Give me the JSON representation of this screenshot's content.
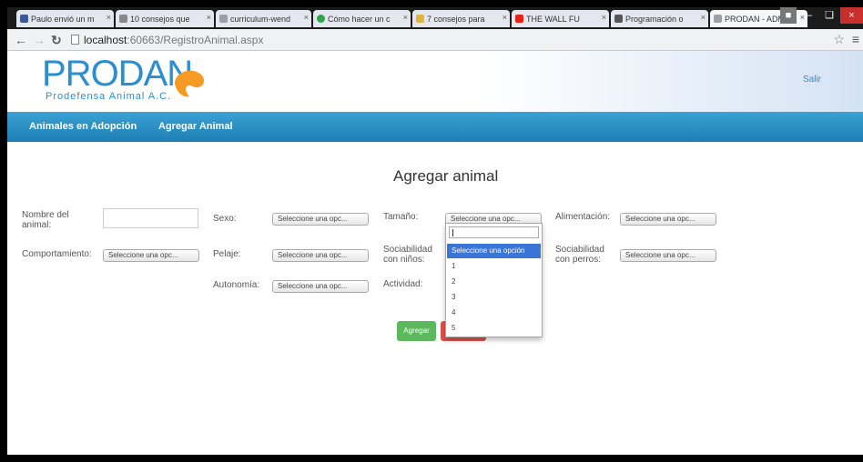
{
  "browser": {
    "tabs": [
      {
        "title": "Paulo envió un m",
        "color": "#3b5998"
      },
      {
        "title": "10 consejos que",
        "color": "#888888"
      },
      {
        "title": "curriculum-wend",
        "color": "#9aa0a6"
      },
      {
        "title": "Cómo hacer un c",
        "color": "#2ea44f"
      },
      {
        "title": "7 consejos para",
        "color": "#e3b341"
      },
      {
        "title": "THE WALL FU",
        "color": "#e62117"
      },
      {
        "title": "Programación o",
        "color": "#555555"
      },
      {
        "title": "PRODAN - ADM",
        "color": "#9aa0a6"
      }
    ],
    "url_host": "localhost",
    "url_path": ":60663/RegistroAnimal.aspx"
  },
  "header": {
    "logo_title": "PRODAN",
    "logo_subtitle": "Prodefensa Animal A.C.",
    "logout_label": "Salir"
  },
  "nav": {
    "adoption_label": "Animales en Adopción",
    "add_label": "Agregar Animal"
  },
  "form": {
    "title": "Agregar animal",
    "labels": {
      "name": "Nombre del animal:",
      "sex": "Sexo:",
      "size": "Tamaño:",
      "food": "Alimentación:",
      "behavior": "Comportamiento:",
      "coat": "Pelaje:",
      "kids": "Sociabilidad con niños:",
      "dogs": "Sociabilidad con perros:",
      "autonomy": "Autonomía:",
      "activity": "Actividad:"
    },
    "select_placeholder": "Seleccione una opc...",
    "name_value": "",
    "submit_label": "Agregar"
  },
  "dropdown": {
    "search_value": "",
    "options": [
      "Seleccione una opción",
      "1",
      "2",
      "3",
      "4",
      "5"
    ],
    "highlighted": 0
  },
  "colors": {
    "brand_blue": "#2a8ed2",
    "nav_blue": "#1e7fb5",
    "success": "#5cb85c",
    "danger": "#d9534f",
    "highlight": "#3875d7"
  }
}
